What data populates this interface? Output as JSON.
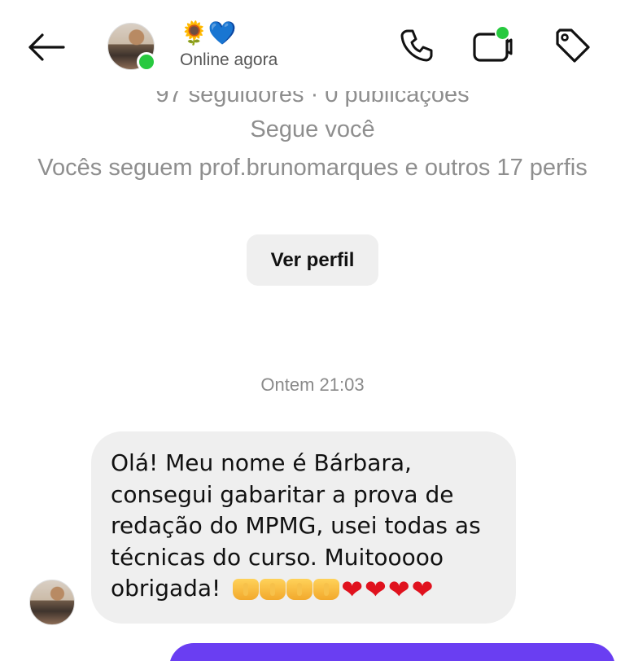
{
  "header": {
    "contact_name": "🌻💙",
    "status": "Online agora",
    "icons": {
      "back": "arrow-left-icon",
      "call": "phone-icon",
      "video": "video-camera-icon",
      "tag": "tag-icon"
    }
  },
  "profile": {
    "stats": "97 seguidores · 0 publicações",
    "follows_you": "Segue você",
    "mutual": "Vocês seguem prof.brunomarques e outros 17 perfis",
    "view_profile_label": "Ver perfil"
  },
  "conversation": {
    "timestamp": "Ontem 21:03",
    "messages": [
      {
        "text_lines": [
          "Olá! Meu nome é Bárbara,",
          "consegui gabaritar a prova de",
          "redação do MPMG, usei todas as",
          "técnicas do curso. Muitooooo",
          "obrigada!"
        ],
        "emoji": {
          "hands": [
            "🙌",
            "🙌",
            "🙌",
            "🙌"
          ],
          "hearts": [
            "❤",
            "❤",
            "❤",
            "❤"
          ]
        }
      }
    ]
  },
  "colors": {
    "online": "#27c93f",
    "bubble_incoming": "#efefef",
    "bubble_outgoing": "#6a3ef2",
    "heart": "#e0121e",
    "muted_text": "#8e8e8e"
  }
}
